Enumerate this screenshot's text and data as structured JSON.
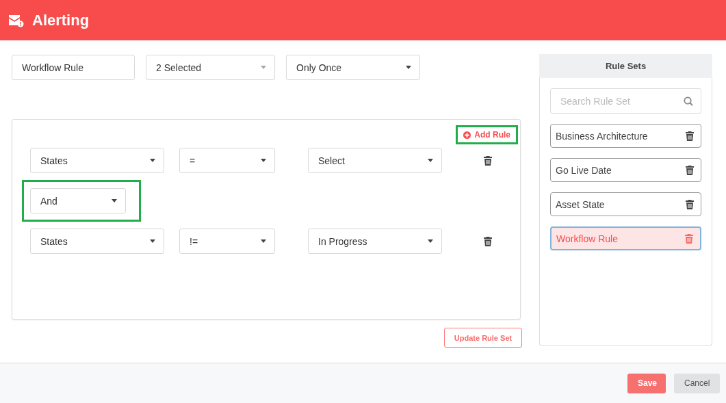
{
  "header": {
    "title": "Alerting"
  },
  "form": {
    "name_field": {
      "value": "Workflow Rule"
    },
    "selects": [
      {
        "value": "2 Selected"
      },
      {
        "value": "Only Once"
      }
    ]
  },
  "rules": {
    "add_rule": {
      "label": "Add Rule",
      "highlighted": true
    },
    "items": [
      {
        "kind": "condition",
        "field": "States",
        "operator": "=",
        "value": "Select"
      },
      {
        "kind": "connector",
        "value": "And",
        "highlighted": true
      },
      {
        "kind": "condition",
        "field": "States",
        "operator": "!=",
        "value": "In Progress"
      }
    ]
  },
  "update_button": {
    "label": "Update Rule Set"
  },
  "rule_sets": {
    "title": "Rule Sets",
    "search": {
      "placeholder": "Search Rule Set"
    },
    "items": [
      {
        "label": "Business Architecture",
        "selected": false
      },
      {
        "label": "Go Live Date",
        "selected": false
      },
      {
        "label": "Asset State",
        "selected": false
      },
      {
        "label": "Workflow Rule",
        "selected": true
      }
    ]
  },
  "footer": {
    "buttons": [
      {
        "label": "Save",
        "kind": "primary"
      },
      {
        "label": "Cancel",
        "kind": "secondary"
      }
    ]
  }
}
